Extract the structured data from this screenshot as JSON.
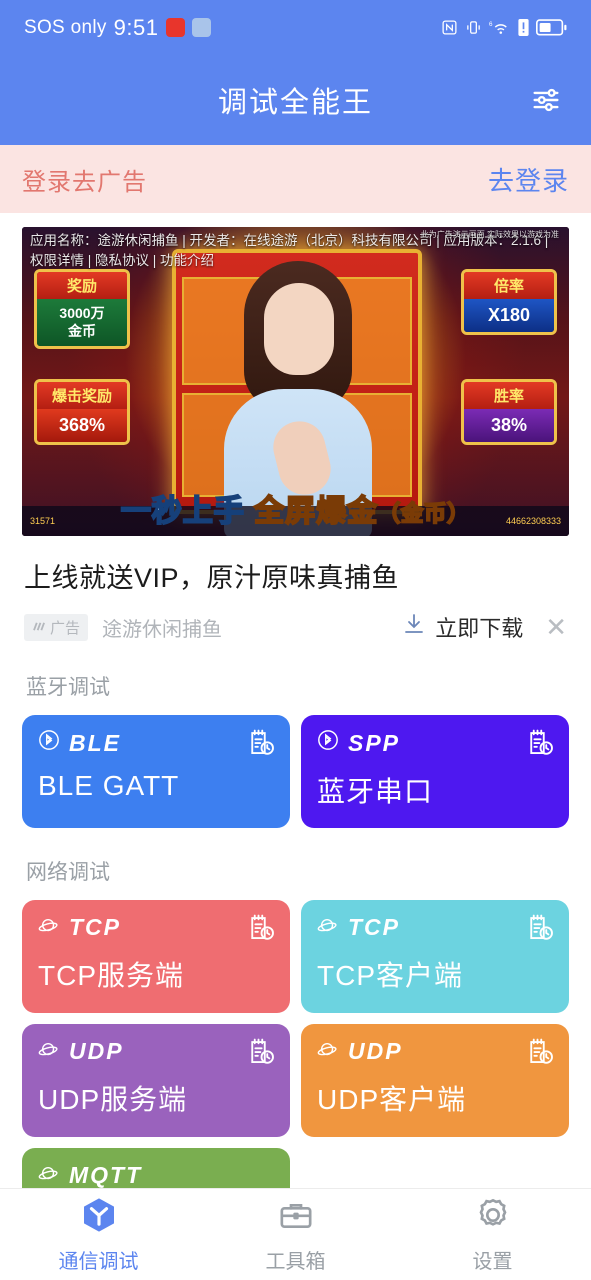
{
  "status_bar": {
    "carrier": "SOS only",
    "time": "9:51",
    "app_icon_1": "red-app-icon",
    "app_icon_2": "blue-app-icon",
    "icons": [
      "nfc-icon",
      "vibrate-icon",
      "wifi-6-icon",
      "sim-alert-icon",
      "battery-icon"
    ],
    "background_color": "#5c85ef"
  },
  "app_bar": {
    "title": "调试全能王",
    "action_icon": "sliders-settings-icon"
  },
  "login_banner": {
    "left_text": "登录去广告",
    "right_text": "去登录",
    "background_color": "#fbe4e2",
    "left_color": "#e2776f",
    "right_color": "#5c85ef"
  },
  "ad": {
    "disclaimer": "应用名称：途游休闲捕鱼 | 开发者：在线途游（北京）科技有限公司 | 应用版本：2.1.6 | 权限详情 | 隐私协议 | 功能介绍",
    "note": "此为广告演示画面 实际效果以游戏为准",
    "slogan_a": "一秒上手",
    "slogan_b": "全屏爆金",
    "slogan_c": "（金币）",
    "panels": [
      {
        "cap": "奖励",
        "val": "3000万\n金币"
      },
      {
        "cap": "爆击奖励",
        "val": "368%"
      },
      {
        "cap": "倍率",
        "val": "X180"
      },
      {
        "cap": "胜率",
        "val": "38%"
      }
    ],
    "coin_left": "31571",
    "coin_right": "44662308333",
    "title": "上线就送VIP，原汁原味真捕鱼",
    "badge_label": "广告",
    "badge_icon": "ad-lines-icon",
    "sponsor": "途游休闲捕鱼",
    "download_label": "立即下载",
    "download_icon": "download-icon",
    "close_icon": "close-icon"
  },
  "sections": [
    {
      "title": "蓝牙调试",
      "cards": [
        {
          "proto": "BLE",
          "name": "BLE GATT",
          "color": "#3d7ff0",
          "proto_icon": "bluetooth-icon",
          "history_icon": "history-clipboard-icon"
        },
        {
          "proto": "SPP",
          "name": "蓝牙串口",
          "color": "#4e18f0",
          "proto_icon": "bluetooth-icon",
          "history_icon": "history-clipboard-icon"
        }
      ]
    },
    {
      "title": "网络调试",
      "cards": [
        {
          "proto": "TCP",
          "name": "TCP服务端",
          "color": "#ef6d71",
          "proto_icon": "globe-icon",
          "history_icon": "history-clipboard-icon"
        },
        {
          "proto": "TCP",
          "name": "TCP客户端",
          "color": "#6cd3e0",
          "proto_icon": "globe-icon",
          "history_icon": "history-clipboard-icon"
        },
        {
          "proto": "UDP",
          "name": "UDP服务端",
          "color": "#9a62bd",
          "proto_icon": "globe-icon",
          "history_icon": "history-clipboard-icon"
        },
        {
          "proto": "UDP",
          "name": "UDP客户端",
          "color": "#f0963f",
          "proto_icon": "globe-icon",
          "history_icon": "history-clipboard-icon"
        },
        {
          "proto": "MQTT",
          "name": "",
          "color": "#7aae50",
          "proto_icon": "globe-icon",
          "history_icon": "history-clipboard-icon"
        }
      ]
    }
  ],
  "bottom_nav": {
    "active_color": "#5c85ef",
    "inactive_color": "#9aa0a6",
    "items": [
      {
        "label": "通信调试",
        "icon": "cube-y-icon",
        "active": true
      },
      {
        "label": "工具箱",
        "icon": "toolbox-icon",
        "active": false
      },
      {
        "label": "设置",
        "icon": "gear-icon",
        "active": false
      }
    ]
  }
}
